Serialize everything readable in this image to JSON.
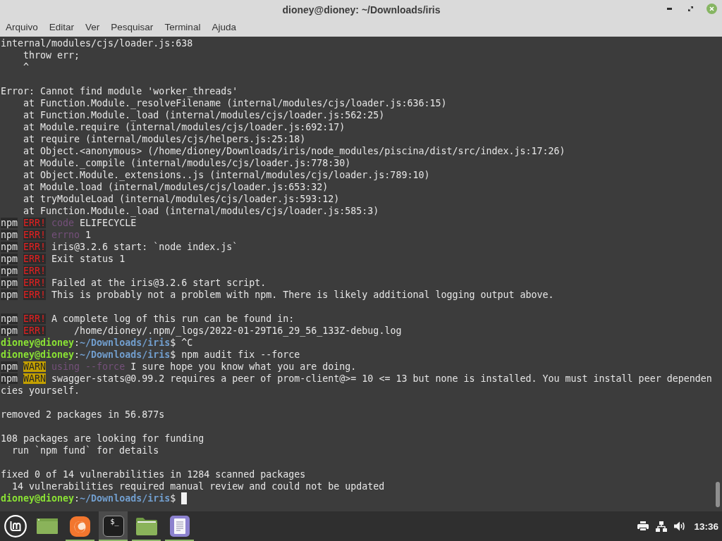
{
  "window": {
    "title": "dioney@dioney: ~/Downloads/iris"
  },
  "menu": [
    "Arquivo",
    "Editar",
    "Ver",
    "Pesquisar",
    "Terminal",
    "Ajuda"
  ],
  "terminal": {
    "blocks": [
      {
        "lines": [
          {
            "segments": [
              {
                "kind": "text",
                "text": "internal/modules/cjs/loader.js:638"
              }
            ]
          },
          {
            "segments": [
              {
                "kind": "text",
                "text": "    throw err;"
              }
            ]
          },
          {
            "segments": [
              {
                "kind": "text",
                "text": "    ^"
              }
            ]
          }
        ]
      },
      {
        "lines": [
          {
            "segments": [
              {
                "kind": "text",
                "text": "Error: Cannot find module 'worker_threads'"
              }
            ]
          },
          {
            "segments": [
              {
                "kind": "text",
                "text": "    at Function.Module._resolveFilename (internal/modules/cjs/loader.js:636:15)"
              }
            ]
          },
          {
            "segments": [
              {
                "kind": "text",
                "text": "    at Function.Module._load (internal/modules/cjs/loader.js:562:25)"
              }
            ]
          },
          {
            "segments": [
              {
                "kind": "text",
                "text": "    at Module.require (internal/modules/cjs/loader.js:692:17)"
              }
            ]
          },
          {
            "segments": [
              {
                "kind": "text",
                "text": "    at require (internal/modules/cjs/helpers.js:25:18)"
              }
            ]
          },
          {
            "segments": [
              {
                "kind": "text",
                "text": "    at Object.<anonymous> (/home/dioney/Downloads/iris/node_modules/piscina/dist/src/index.js:17:26)"
              }
            ]
          },
          {
            "segments": [
              {
                "kind": "text",
                "text": "    at Module._compile (internal/modules/cjs/loader.js:778:30)"
              }
            ]
          },
          {
            "segments": [
              {
                "kind": "text",
                "text": "    at Object.Module._extensions..js (internal/modules/cjs/loader.js:789:10)"
              }
            ]
          },
          {
            "segments": [
              {
                "kind": "text",
                "text": "    at Module.load (internal/modules/cjs/loader.js:653:32)"
              }
            ]
          },
          {
            "segments": [
              {
                "kind": "text",
                "text": "    at tryModuleLoad (internal/modules/cjs/loader.js:593:12)"
              }
            ]
          },
          {
            "segments": [
              {
                "kind": "text",
                "text": "    at Function.Module._load (internal/modules/cjs/loader.js:585:3)"
              }
            ]
          },
          {
            "segments": [
              {
                "kind": "npm",
                "text": "npm"
              },
              {
                "kind": "err",
                "text": "ERR!"
              },
              {
                "kind": "dim",
                "text": "code"
              },
              {
                "kind": "text",
                "text": " ELIFECYCLE"
              }
            ]
          },
          {
            "segments": [
              {
                "kind": "npm",
                "text": "npm"
              },
              {
                "kind": "err",
                "text": "ERR!"
              },
              {
                "kind": "dim",
                "text": "errno"
              },
              {
                "kind": "text",
                "text": " 1"
              }
            ]
          },
          {
            "segments": [
              {
                "kind": "npm",
                "text": "npm"
              },
              {
                "kind": "err",
                "text": "ERR!"
              },
              {
                "kind": "text",
                "text": "iris@3.2.6 start: `node index.js`"
              }
            ]
          },
          {
            "segments": [
              {
                "kind": "npm",
                "text": "npm"
              },
              {
                "kind": "err",
                "text": "ERR!"
              },
              {
                "kind": "text",
                "text": "Exit status 1"
              }
            ]
          },
          {
            "segments": [
              {
                "kind": "npm",
                "text": "npm"
              },
              {
                "kind": "err",
                "text": "ERR!"
              }
            ]
          },
          {
            "segments": [
              {
                "kind": "npm",
                "text": "npm"
              },
              {
                "kind": "err",
                "text": "ERR!"
              },
              {
                "kind": "text",
                "text": "Failed at the iris@3.2.6 start script."
              }
            ]
          },
          {
            "segments": [
              {
                "kind": "npm",
                "text": "npm"
              },
              {
                "kind": "err",
                "text": "ERR!"
              },
              {
                "kind": "text",
                "text": "This is probably not a problem with npm. There is likely additional logging output above."
              }
            ]
          }
        ]
      },
      {
        "lines": [
          {
            "segments": [
              {
                "kind": "npm",
                "text": "npm"
              },
              {
                "kind": "err",
                "text": "ERR!"
              },
              {
                "kind": "text",
                "text": "A complete log of this run can be found in:"
              }
            ]
          },
          {
            "segments": [
              {
                "kind": "npm",
                "text": "npm"
              },
              {
                "kind": "err",
                "text": "ERR!"
              },
              {
                "kind": "text",
                "text": "    /home/dioney/.npm/_logs/2022-01-29T16_29_56_133Z-debug.log"
              }
            ]
          },
          {
            "segments": [
              {
                "kind": "user",
                "text": "dioney@dioney"
              },
              {
                "kind": "text",
                "text": ":"
              },
              {
                "kind": "path",
                "text": "~/Downloads/iris"
              },
              {
                "kind": "text",
                "text": "$ ^C"
              }
            ]
          },
          {
            "segments": [
              {
                "kind": "user",
                "text": "dioney@dioney"
              },
              {
                "kind": "text",
                "text": ":"
              },
              {
                "kind": "path",
                "text": "~/Downloads/iris"
              },
              {
                "kind": "text",
                "text": "$ npm audit fix --force"
              }
            ]
          },
          {
            "segments": [
              {
                "kind": "npm",
                "text": "npm"
              },
              {
                "kind": "warn",
                "text": "WARN"
              },
              {
                "kind": "dim",
                "text": "using --force"
              },
              {
                "kind": "text",
                "text": " I sure hope you know what you are doing."
              }
            ]
          },
          {
            "segments": [
              {
                "kind": "npm",
                "text": "npm"
              },
              {
                "kind": "warn",
                "text": "WARN"
              },
              {
                "kind": "text",
                "text": "swagger-stats@0.99.2 requires a peer of prom-client@>= 10 <= 13 but none is installed. You must install peer dependen"
              }
            ]
          },
          {
            "segments": [
              {
                "kind": "text",
                "text": "cies yourself."
              }
            ]
          }
        ]
      },
      {
        "lines": [
          {
            "segments": [
              {
                "kind": "text",
                "text": "removed 2 packages in 56.877s"
              }
            ]
          }
        ]
      },
      {
        "lines": [
          {
            "segments": [
              {
                "kind": "text",
                "text": "108 packages are looking for funding"
              }
            ]
          },
          {
            "segments": [
              {
                "kind": "text",
                "text": "  run `npm fund` for details"
              }
            ]
          }
        ]
      },
      {
        "lines": [
          {
            "segments": [
              {
                "kind": "text",
                "text": "fixed 0 of 14 vulnerabilities in 1284 scanned packages"
              }
            ]
          },
          {
            "segments": [
              {
                "kind": "text",
                "text": "  14 vulnerabilities required manual review and could not be updated"
              }
            ]
          },
          {
            "segments": [
              {
                "kind": "user",
                "text": "dioney@dioney"
              },
              {
                "kind": "text",
                "text": ":"
              },
              {
                "kind": "path",
                "text": "~/Downloads/iris"
              },
              {
                "kind": "text",
                "text": "$"
              },
              {
                "kind": "cursor"
              }
            ]
          }
        ]
      }
    ]
  },
  "taskbar": {
    "apps": [
      {
        "kind": "desktop",
        "running": false,
        "selected": false
      },
      {
        "kind": "browser",
        "running": true,
        "selected": false
      },
      {
        "kind": "terminal",
        "glyph": "$_",
        "running": true,
        "selected": true
      },
      {
        "kind": "folder",
        "running": true,
        "selected": false
      },
      {
        "kind": "editor",
        "running": true,
        "selected": false
      }
    ],
    "clock": "13:36"
  }
}
